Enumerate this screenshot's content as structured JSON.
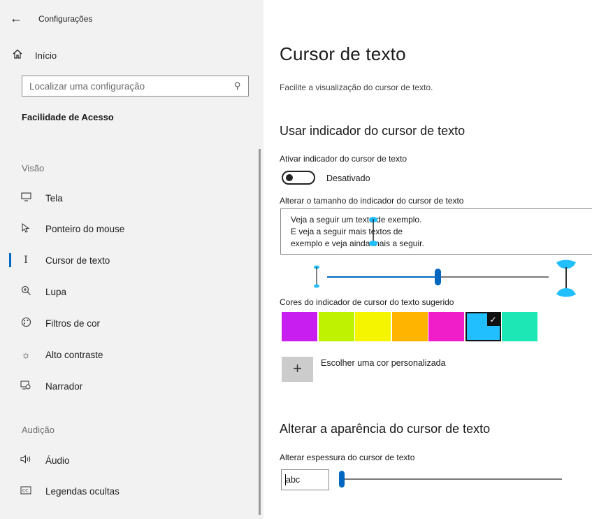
{
  "app": {
    "title": "Configurações",
    "back_icon": "back-arrow-icon"
  },
  "sidebar": {
    "home_label": "Início",
    "search_placeholder": "Localizar uma configuração",
    "section_title": "Facilidade de Acesso",
    "groups": [
      {
        "title": "Visão",
        "items": [
          {
            "label": "Tela",
            "icon": "monitor-icon"
          },
          {
            "label": "Ponteiro do mouse",
            "icon": "mouse-pointer-icon"
          },
          {
            "label": "Cursor de texto",
            "icon": "text-cursor-icon",
            "selected": true
          },
          {
            "label": "Lupa",
            "icon": "magnifier-icon"
          },
          {
            "label": "Filtros de cor",
            "icon": "color-filter-icon"
          },
          {
            "label": "Alto contraste",
            "icon": "high-contrast-icon"
          },
          {
            "label": "Narrador",
            "icon": "narrator-icon"
          }
        ]
      },
      {
        "title": "Audição",
        "items": [
          {
            "label": "Áudio",
            "icon": "speaker-icon"
          },
          {
            "label": "Legendas ocultas",
            "icon": "closed-captions-icon"
          }
        ]
      }
    ]
  },
  "main": {
    "title": "Cursor de texto",
    "description": "Facilite a visualização do cursor de texto.",
    "indicator_section": {
      "heading": "Usar indicador do cursor de texto",
      "toggle_label": "Ativar indicador do cursor de texto",
      "toggle_state": "Desativado",
      "toggle_on": false,
      "size_label": "Alterar o tamanho do indicador do cursor de texto",
      "preview_lines": [
        "Veja a seguir um texto de exemplo.",
        "E veja a seguir mais textos de",
        "exemplo e veja ainda mais a seguir."
      ],
      "size_slider_value": 0.5,
      "colors_label": "Cores do indicador de cursor do texto sugerido",
      "colors": [
        "#c81ef0",
        "#bff200",
        "#f5f500",
        "#ffb400",
        "#f01ec8",
        "#22bfff",
        "#1de7b4"
      ],
      "selected_color_index": 5,
      "indicator_color": "#22bfff",
      "custom_color_label": "Escolher uma cor personalizada"
    },
    "appearance_section": {
      "heading": "Alterar a aparência do cursor de texto",
      "thickness_label": "Alterar espessura do cursor de texto",
      "preview_text": "abc",
      "thickness_value": 1
    },
    "accent_color": "#0067c0"
  }
}
